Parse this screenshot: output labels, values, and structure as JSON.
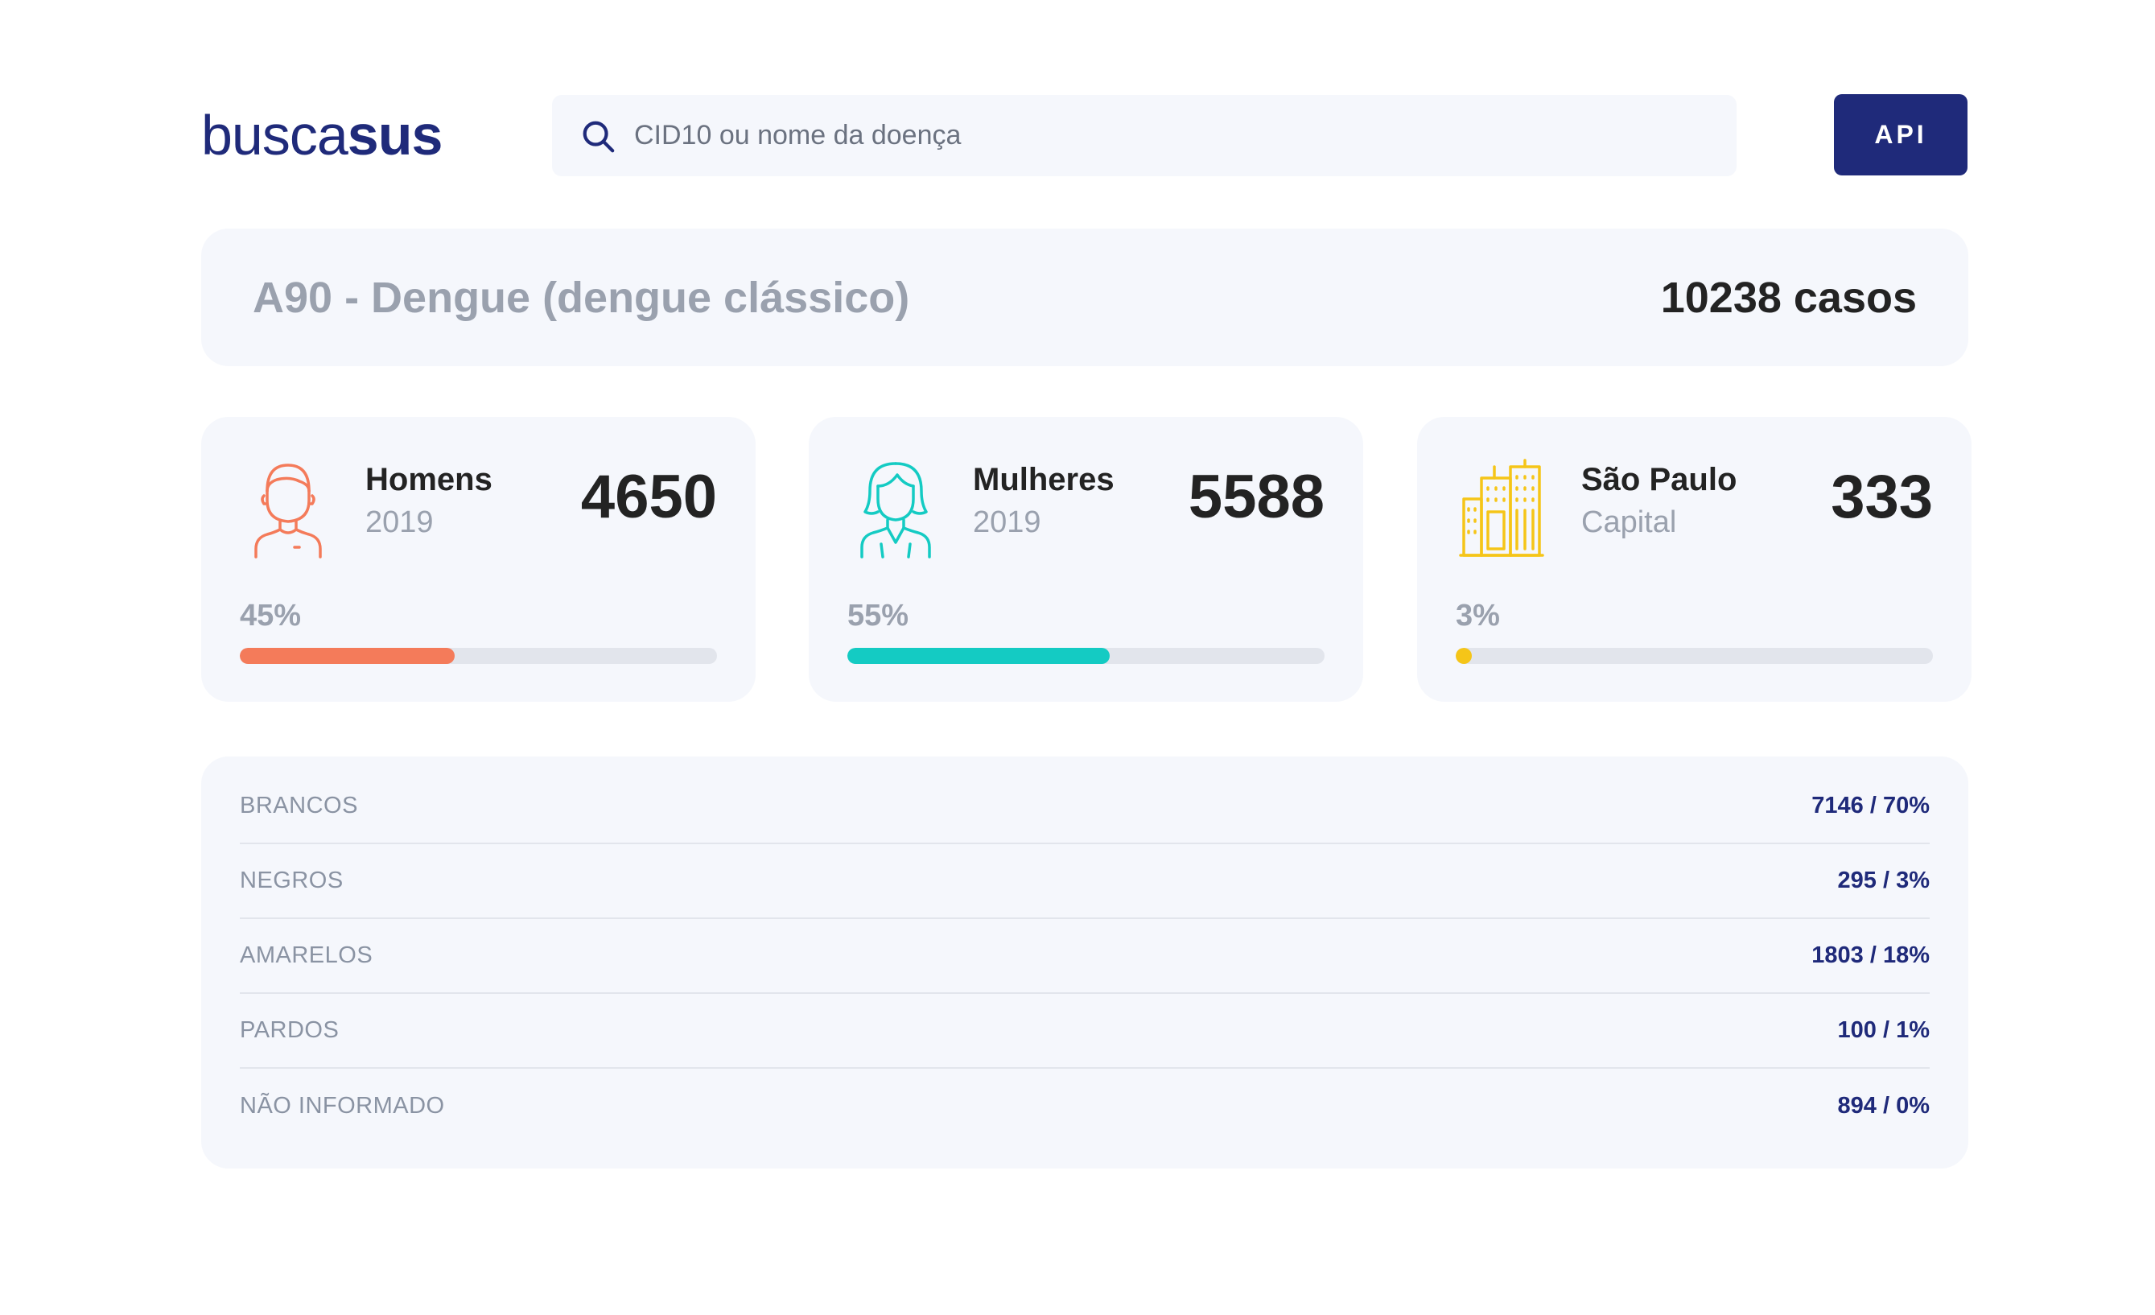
{
  "header": {
    "logo_light": "busca",
    "logo_bold": "sus",
    "search_placeholder": "CID10 ou nome da doença",
    "api_label": "API"
  },
  "banner": {
    "title": "A90 - Dengue (dengue clássico)",
    "cases": "10238 casos"
  },
  "cards": [
    {
      "label": "Homens",
      "sub": "2019",
      "value": "4650",
      "pct_label": "45%",
      "fraction": 0.45,
      "color": "#f47b5a",
      "icon": "man-icon"
    },
    {
      "label": "Mulheres",
      "sub": "2019",
      "value": "5588",
      "pct_label": "55%",
      "fraction": 0.55,
      "color": "#14cbc3",
      "icon": "woman-icon"
    },
    {
      "label": "São Paulo",
      "sub": "Capital",
      "value": "333",
      "pct_label": "3%",
      "fraction": 0.03,
      "color": "#f5c518",
      "icon": "city-buildings-icon"
    }
  ],
  "races": [
    {
      "name": "BRANCOS",
      "value": "7146 / 70%"
    },
    {
      "name": "NEGROS",
      "value": "295 / 3%"
    },
    {
      "name": "AMARELOS",
      "value": "1803 / 18%"
    },
    {
      "name": "PARDOS",
      "value": "100 / 1%"
    },
    {
      "name": "NÃO INFORMADO",
      "value": "894 / 0%"
    }
  ],
  "colors": {
    "brand": "#1f2a7a",
    "panel": "#f5f7fc",
    "muted": "#9aa1ae"
  }
}
